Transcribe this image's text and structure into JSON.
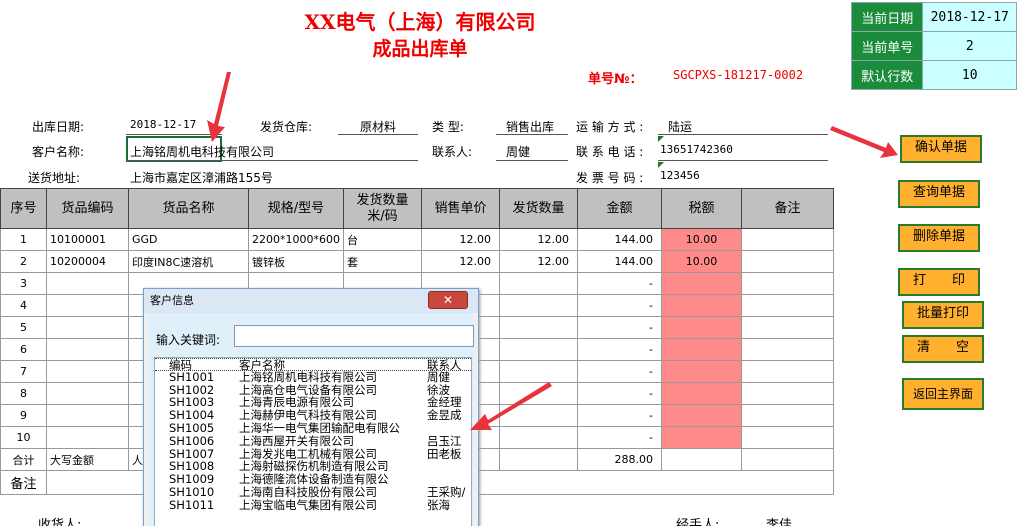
{
  "header": {
    "company": "XX电气（上海）有限公司",
    "doc_title": "成品出库单",
    "order_no_label": "单号№：",
    "order_no": "SGCPXS-181217-0002"
  },
  "info": {
    "date_label": "当前日期",
    "date_value": "2018-12-17",
    "num_label": "当前单号",
    "num_value": "2",
    "rows_label": "默认行数",
    "rows_value": "10"
  },
  "form": {
    "out_date_label": "出库日期:",
    "out_date": "2018-12-17",
    "warehouse_label": "发货仓库:",
    "warehouse": "原材料",
    "type_label": "类    型:",
    "type": "销售出库",
    "transport_label": "运 输 方 式 :",
    "transport": "陆运",
    "customer_label": "客户名称:",
    "customer": "上海铭周机电科技有限公司",
    "contact_label": "联系人:",
    "contact": "周健",
    "phone_label": "联 系 电 话 :",
    "phone": "13651742360",
    "address_label": "送货地址:",
    "address": "上海市嘉定区漳浦路155号",
    "invoice_label": "发 票 号 码 :",
    "invoice": "123456"
  },
  "table": {
    "headers": [
      "序号",
      "货品编码",
      "货品名称",
      "规格/型号",
      "发货数量\n米/码",
      "销售单价",
      "发货数量",
      "金额",
      "税额",
      "备注"
    ],
    "rows": [
      {
        "no": "1",
        "code": "10100001",
        "name": "GGD",
        "spec": "2200*1000*600",
        "unit": "台",
        "price": "12.00",
        "qty": "12.00",
        "amount": "144.00",
        "tax": "10.00",
        "note": ""
      },
      {
        "no": "2",
        "code": "10200004",
        "name": "印度IN8C速溶机",
        "spec": "镀锌板",
        "unit": "套",
        "price": "12.00",
        "qty": "12.00",
        "amount": "144.00",
        "tax": "10.00",
        "note": ""
      },
      {
        "no": "3",
        "code": "",
        "name": "",
        "spec": "",
        "unit": "",
        "price": "",
        "qty": "",
        "amount": "-",
        "tax": "",
        "note": ""
      },
      {
        "no": "4",
        "code": "",
        "name": "",
        "spec": "",
        "unit": "",
        "price": "",
        "qty": "",
        "amount": "-",
        "tax": "",
        "note": ""
      },
      {
        "no": "5",
        "code": "",
        "name": "",
        "spec": "",
        "unit": "",
        "price": "",
        "qty": "",
        "amount": "-",
        "tax": "",
        "note": ""
      },
      {
        "no": "6",
        "code": "",
        "name": "",
        "spec": "",
        "unit": "",
        "price": "",
        "qty": "",
        "amount": "-",
        "tax": "",
        "note": ""
      },
      {
        "no": "7",
        "code": "",
        "name": "",
        "spec": "",
        "unit": "",
        "price": "",
        "qty": "",
        "amount": "-",
        "tax": "",
        "note": ""
      },
      {
        "no": "8",
        "code": "",
        "name": "",
        "spec": "",
        "unit": "",
        "price": "",
        "qty": "",
        "amount": "-",
        "tax": "",
        "note": ""
      },
      {
        "no": "9",
        "code": "",
        "name": "",
        "spec": "",
        "unit": "",
        "price": "",
        "qty": "",
        "amount": "-",
        "tax": "",
        "note": ""
      },
      {
        "no": "10",
        "code": "",
        "name": "",
        "spec": "",
        "unit": "",
        "price": "",
        "qty": "",
        "amount": "-",
        "tax": "",
        "note": ""
      }
    ],
    "total_label": "合计",
    "total_words_label": "大写金额",
    "total_words_value": "人",
    "total_amount": "288.00",
    "remark_label": "备注"
  },
  "footer": {
    "receiver_label": "收货人:",
    "handler_label": "经手人:",
    "handler": "李佳"
  },
  "buttons": {
    "confirm": "确认单据",
    "query": "查询单据",
    "delete": "删除单据",
    "print": "打　　印",
    "batch_print": "批量打印",
    "clear": "清　　空",
    "back": "返回主界面"
  },
  "popup": {
    "title": "客户信息",
    "close_icon": "close-icon",
    "keyword_label": "输入关键词:",
    "keyword_value": "",
    "columns": [
      "编码",
      "客户名称",
      "联系人"
    ],
    "rows": [
      {
        "code": "SH1001",
        "name": "上海铭周机电科技有限公司",
        "contact": "周健"
      },
      {
        "code": "SH1002",
        "name": "上海高仓电气设备有限公司",
        "contact": "徐波"
      },
      {
        "code": "SH1003",
        "name": "上海青辰电源有限公司",
        "contact": "金经理"
      },
      {
        "code": "SH1004",
        "name": "上海赫伊电气科技有限公司",
        "contact": "金昱成"
      },
      {
        "code": "SH1005",
        "name": "上海华一电气集团输配电有限公",
        "contact": ""
      },
      {
        "code": "SH1006",
        "name": "上海西屋开关有限公司",
        "contact": "吕玉江"
      },
      {
        "code": "SH1007",
        "name": "上海发兆电工机械有限公司",
        "contact": "田老板"
      },
      {
        "code": "SH1008",
        "name": "上海射磁探伤机制造有限公司",
        "contact": ""
      },
      {
        "code": "SH1009",
        "name": "上海德隆流体设备制造有限公",
        "contact": ""
      },
      {
        "code": "SH1010",
        "name": "上海南自科技股份有限公司",
        "contact": "王采购/"
      },
      {
        "code": "SH1011",
        "name": "上海宝临电气集团有限公司",
        "contact": "张海"
      }
    ]
  },
  "colors": {
    "title_red": "#ee0000",
    "info_key_green": "#1b8c3c",
    "info_value_cyan": "#ccffff",
    "button_orange": "#ffb02e",
    "tax_red": "#ff8a8a",
    "header_gray": "#c0c0c0"
  }
}
